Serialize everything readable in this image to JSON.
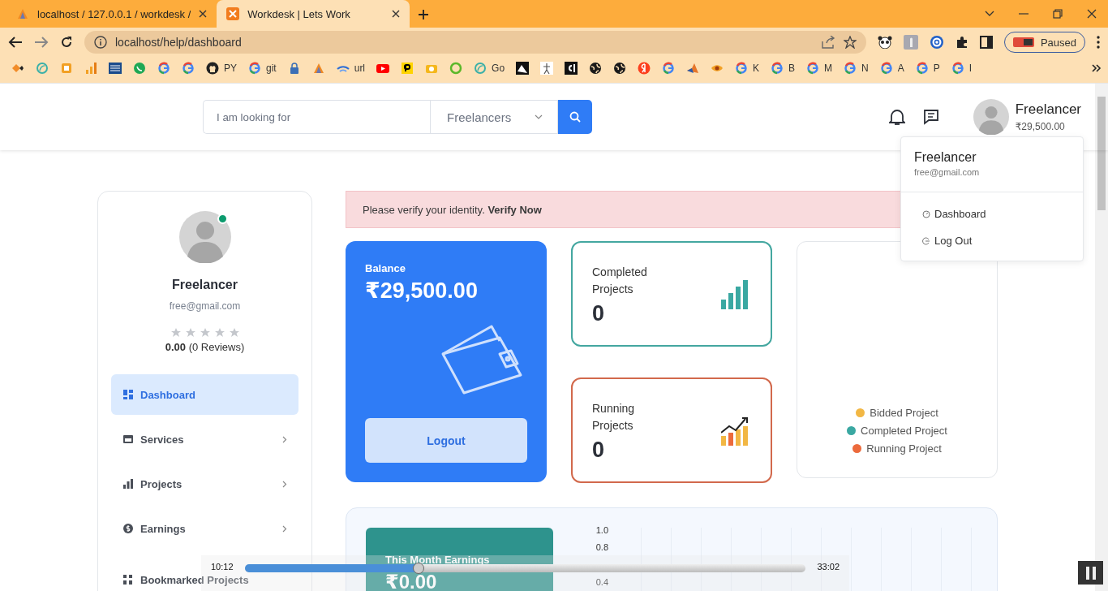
{
  "browser": {
    "tabs": [
      {
        "title": "localhost / 127.0.0.1 / workdesk /",
        "kind": "pma",
        "selected": false
      },
      {
        "title": "Workdesk | Lets Work",
        "kind": "app",
        "selected": true
      }
    ],
    "url": "localhost/help/dashboard",
    "bookmarks": [
      {
        "kind": "diamond"
      },
      {
        "kind": "leaf"
      },
      {
        "kind": "square"
      },
      {
        "kind": "bars"
      },
      {
        "kind": "ieee"
      },
      {
        "kind": "whatsapp"
      },
      {
        "kind": "google"
      },
      {
        "kind": "google"
      },
      {
        "kind": "github",
        "label": "PY"
      },
      {
        "kind": "google",
        "label": "git"
      },
      {
        "kind": "lock"
      },
      {
        "kind": "pma"
      },
      {
        "kind": "wifi",
        "label": "url"
      },
      {
        "kind": "youtube"
      },
      {
        "kind": "pbox"
      },
      {
        "kind": "camera"
      },
      {
        "kind": "ring"
      },
      {
        "kind": "leaf",
        "label": "Go"
      },
      {
        "kind": "photo"
      },
      {
        "kind": "sketch"
      },
      {
        "kind": "cl"
      },
      {
        "kind": "globe"
      },
      {
        "kind": "globe"
      },
      {
        "kind": "yandex"
      },
      {
        "kind": "google"
      },
      {
        "kind": "matlab"
      },
      {
        "kind": "eye"
      },
      {
        "kind": "google",
        "label": "K"
      },
      {
        "kind": "google",
        "label": "B"
      },
      {
        "kind": "google",
        "label": "M"
      },
      {
        "kind": "google",
        "label": "N"
      },
      {
        "kind": "google",
        "label": "A"
      },
      {
        "kind": "google",
        "label": "P"
      },
      {
        "kind": "google",
        "label": "I"
      }
    ],
    "profile_status": "Paused"
  },
  "header": {
    "search": {
      "placeholder": "I am looking for",
      "category": "Freelancers"
    },
    "user": {
      "name": "Freelancer",
      "balance": "₹29,500.00"
    }
  },
  "user_menu": {
    "name": "Freelancer",
    "email": "free@gmail.com",
    "items": [
      {
        "label": "Dashboard",
        "kind": "dashboard"
      },
      {
        "label": "Log Out",
        "kind": "logout"
      }
    ]
  },
  "profile": {
    "name": "Freelancer",
    "email": "free@gmail.com",
    "online": true,
    "stars": 0,
    "rating": "**0.00** (0 Reviews)"
  },
  "sidebar": {
    "items": [
      {
        "label": "Dashboard",
        "kind": "dashboard",
        "selected": true,
        "submenu": false
      },
      {
        "label": "Services",
        "kind": "services",
        "selected": false,
        "submenu": true
      },
      {
        "label": "Projects",
        "kind": "projects",
        "selected": false,
        "submenu": true
      },
      {
        "label": "Earnings",
        "kind": "earnings",
        "selected": false,
        "submenu": true
      },
      {
        "label": "Bookmarked Projects",
        "kind": "bookmarks",
        "selected": false,
        "submenu": false
      }
    ]
  },
  "alert": {
    "text": "Please verify your identity. **Verify Now**"
  },
  "balance_card": {
    "label": "Balance",
    "amount": "₹29,500.00",
    "button": "Logout"
  },
  "stats": [
    {
      "label": "Completed Projects",
      "value": "0",
      "kind": "completed"
    },
    {
      "label": "Running Projects",
      "value": "0",
      "kind": "running"
    }
  ],
  "legend": {
    "items": [
      {
        "label": "Bidded Project",
        "color": "#f2b744"
      },
      {
        "label": "Completed Project",
        "color": "#3aa8a2"
      },
      {
        "label": "Running Project",
        "color": "#ec6a3c"
      }
    ]
  },
  "earnings": {
    "label": "This Month Earnings",
    "amount": "₹0.00",
    "axis_labels": [
      "1.0",
      "0.8",
      "0.4"
    ]
  },
  "video": {
    "elapsed": "10:12",
    "duration": "33:02",
    "level": 0.31
  }
}
